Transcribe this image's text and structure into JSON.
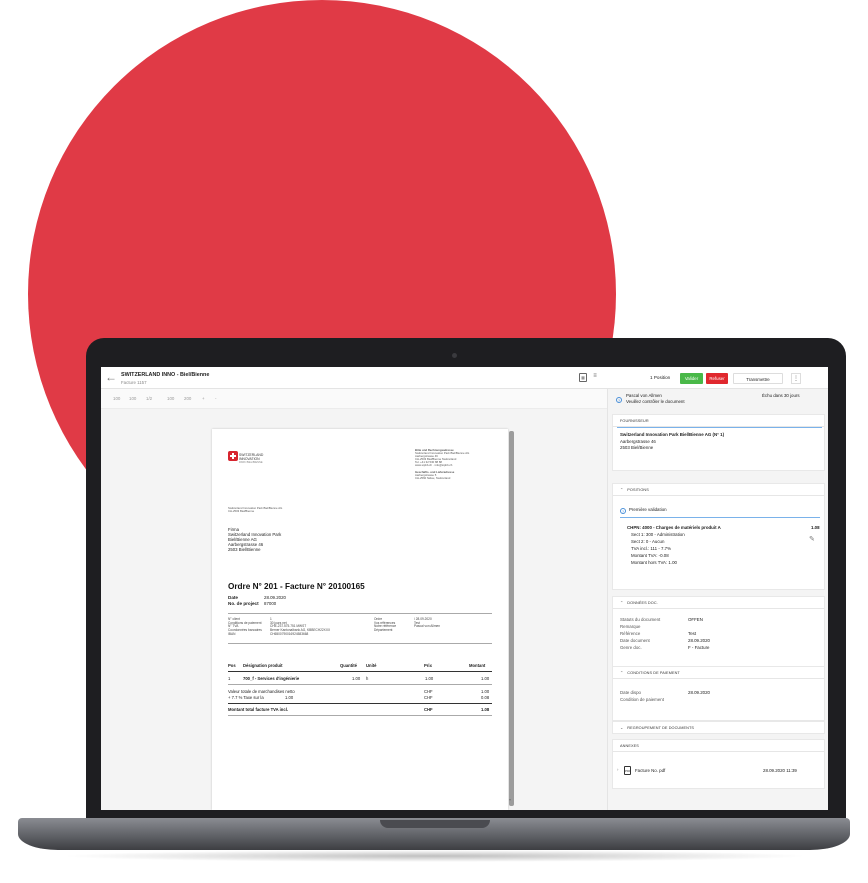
{
  "app": {
    "title": "SWITZERLAND INNO - Biel/Bienne",
    "subtitle": "Facture 1157",
    "positions_count": "1 Position",
    "btn_validate": "Valider",
    "btn_refuse": "Refuser",
    "btn_transmit": "Transmettre",
    "colors": {
      "accent_green": "#49b848",
      "refuse_red": "#e0282e",
      "background_circle": "#e03a46",
      "info_blue": "#4a90d9"
    }
  },
  "toolbar": {
    "items": [
      "100",
      "100",
      "1/2",
      "100",
      "200",
      "+",
      "-"
    ]
  },
  "document": {
    "logo_line1": "SWITZERLAND",
    "logo_line2": "INNOVATION",
    "logo_tagline": "PARK BIEL/BIENNE",
    "header_right_title": "Bitte und Rechnungsadresse",
    "header_right_lines": [
      "Switzerland Innovation Park Biel/Bienne AG",
      "Aarbergstrasse 46",
      "CH-2503 Biel/Bienne Switzerland",
      "Tel. +41 32 530 88 88",
      "www.sipbb.ch · info@sipbb.ch"
    ],
    "header_right2_title": "Geschäfts- und Lieferadresse",
    "header_right2_lines": [
      "Aarbergstrasse 5",
      "CH-2560 Nidau, Switzerland"
    ],
    "sender_small": "Switzerland Innovation Park Biel/Bienne AG",
    "sender_small2": "CH-2503 Biel/Bienne",
    "addr": [
      "Firma",
      "Switzerland Innovation Park",
      "Biel/Bienne AG",
      "Aarbergstrasse 46",
      "2503 Biel/Bienne"
    ],
    "order_title": "Ordre N° 201 - Facture N° 20100165",
    "date_label": "Date",
    "date_value": "28.09.2020",
    "project_label": "No. de project",
    "project_value": "87000",
    "meta_left_labels": [
      "N° client",
      "Conditions de paiement",
      "N° TVA",
      "Coordonnées bancaires",
      "IBAN"
    ],
    "meta_left_values": [
      "1",
      "30 jours net",
      "CHE-237.575.751 MWST",
      "Berner Kantonalbank AG, KBBECH22XXX",
      "CH6500790016924583668"
    ],
    "meta_right_labels": [
      "Ordre",
      "Vos références",
      "Notre référence",
      "Département"
    ],
    "meta_right_values": [
      "/ 28.09.2020",
      "Test",
      "Pascal von Allmen",
      ""
    ],
    "table_headers": {
      "pos": "Pos",
      "designation": "Désignation produit",
      "qty": "Quantité",
      "unit": "Unité",
      "price": "Prix",
      "amount": "Montant"
    },
    "row": {
      "pos": "1",
      "designation": "700_f - Services d'ingénierie",
      "qty": "1.00",
      "unit": "h",
      "price": "1.00",
      "amount": "1.00"
    },
    "net_label": "Valeur totale de marchandises netto",
    "net_currency": "CHF",
    "net_amount": "1.00",
    "tax_label": "+ 7.7 % Taxe sur la",
    "tax_base": "1.00",
    "tax_currency": "CHF",
    "tax_amount": "0.08",
    "total_label": "Montant total facture TVA incl.",
    "total_currency": "CHF",
    "total_amount": "1.08"
  },
  "panel": {
    "assignee": "Pascal von Allmen",
    "instruction": "Veuillez contrôler le document",
    "due": "Échu dans 30 jours",
    "supplier_head": "FOURNISSEUR",
    "supplier_name": "Switzerland Innovation Park Biel/Bienne AG (N° 1)",
    "supplier_street": "Aarbergstrasse 46",
    "supplier_city": "2503 Biel/Bienne",
    "positions_head": "POSITIONS",
    "first_validation": "Première validation",
    "position_title": "CHPN: 4000 - Charges de matériels produit A",
    "position_amount": "1.08",
    "position_lines": [
      "Sect 1: 300 - Administration",
      "Sect 2: 0 - Aucun",
      "TVA incl.: 111 - 7.7%",
      "Montant TVA: -0.08",
      "Montant hors TVA: 1.00"
    ],
    "doc_head": "DONNÉES DOC.",
    "doc_labels": [
      "Statuts du document",
      "Remarque",
      "Référence",
      "Date document",
      "Genre doc."
    ],
    "doc_values": [
      "OFFEN",
      "",
      "Test",
      "28.09.2020",
      "F - Facture"
    ],
    "pay_head": "CONDITIONS DE PAIEMENT",
    "pay_labels": [
      "Date dispo",
      "Condition de paiement"
    ],
    "pay_values": [
      "28.09.2020",
      ""
    ],
    "grouping_head": "REGROUPEMENT DE DOCUMENTS",
    "annex_head": "ANNEXES",
    "annex_file": "Facture No. pdf",
    "annex_date": "28.09.2020 11:39"
  }
}
